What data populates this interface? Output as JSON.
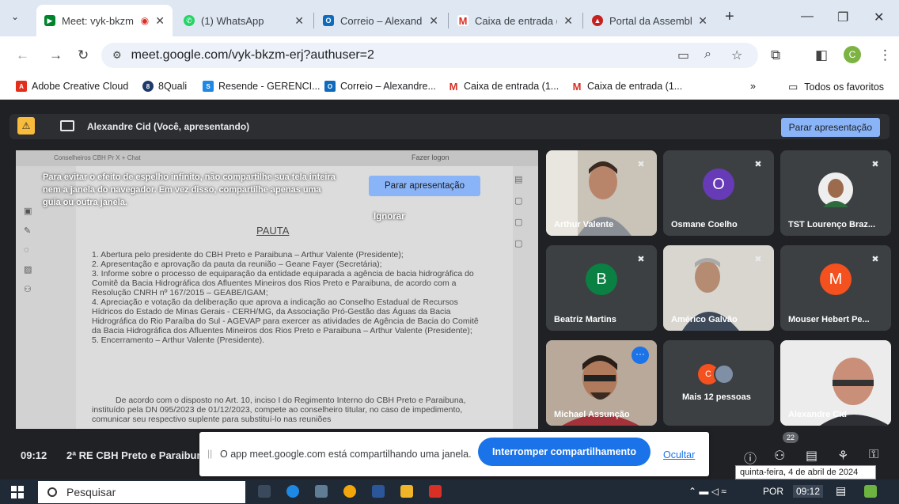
{
  "browser": {
    "tabs": [
      {
        "title": "Meet: vyk-bkzm",
        "active": true
      },
      {
        "title": "(1) WhatsApp",
        "active": false
      },
      {
        "title": "Correio – Alexandre",
        "active": false
      },
      {
        "title": "Caixa de entrada (",
        "active": false
      },
      {
        "title": "Portal da Assembl",
        "active": false
      }
    ],
    "new_tab": "+",
    "url": "meet.google.com/vyk-bkzm-erj?authuser=2",
    "profile_initial": "C",
    "bookmarks": [
      "Adobe Creative Cloud",
      "8Quali",
      "Resende - GERENCI...",
      "Correio – Alexandre...",
      "Caixa de entrada (1...",
      "Caixa de entrada (1..."
    ],
    "bookmarks_more": "»",
    "all_favorites": "Todos os favoritos"
  },
  "meet": {
    "presenter_text": "Alexandre Cid (Você, apresentando)",
    "stop_presenting": "Parar apresentação",
    "warning": "Para evitar o efeito de espelho infinito, não compartilhe sua tela inteira nem a janela do navegador. Em vez disso, compartilhe apenas uma guia ou outra janela.",
    "stop_presenting_2": "Parar apresentação",
    "ignore": "Ignorar",
    "shared_window": {
      "title_bits": "Conselheiros CBH Pr   X   + Chat",
      "login": "Fazer logon",
      "doc_title": "PAUTA",
      "items": [
        "1. Abertura pelo presidente do CBH Preto e Paraibuna – Arthur Valente (Presidente);",
        "2. Apresentação e aprovação da pauta da reunião – Geane Fayer (Secretária);",
        "3. Informe sobre o processo de equiparação da entidade equiparada a agência de bacia hidrográfica do Comitê da Bacia Hidrográfica dos Afluentes Mineiros dos Rios Preto e Paraibuna, de acordo com a Resolução CNRH nº 167/2015 – GEABE/IGAM;",
        "4. Apreciação e votação da deliberação que aprova a indicação ao Conselho Estadual de Recursos Hídricos do Estado de Minas Gerais - CERH/MG, da Associação Pró-Gestão das Águas da Bacia Hidrográfica do Rio Paraíba do Sul - AGEVAP para exercer as atividades de Agência de Bacia do Comitê da Bacia Hidrográfica dos Afluentes Mineiros dos Rios Preto e Paraibuna – Arthur Valente (Presidente);",
        "5. Encerramento – Arthur Valente (Presidente)."
      ],
      "paragraph": "De acordo com o disposto no Art. 10, inciso I do Regimento Interno do CBH Preto e Paraibuna, instituído pela DN 095/2023 de 01/12/2023, compete ao conselheiro titular, no caso de impedimento, comunicar seu respectivo suplente para substituí-lo nas reuniões"
    },
    "participants": [
      {
        "name": "Arthur Valente",
        "type": "photo"
      },
      {
        "name": "Osmane Coelho",
        "type": "avatar",
        "initial": "O",
        "color": "#673ab7"
      },
      {
        "name": "TST Lourenço Braz...",
        "type": "photo"
      },
      {
        "name": "Beatriz Martins",
        "type": "avatar",
        "initial": "B",
        "color": "#0b8043"
      },
      {
        "name": "Américo Galvão",
        "type": "photo"
      },
      {
        "name": "Mouser Hebert Pe...",
        "type": "avatar",
        "initial": "M",
        "color": "#f4511e"
      },
      {
        "name": "Michael Assunção",
        "type": "photo"
      },
      {
        "name": "Mais 12 pessoas",
        "type": "group",
        "initial": "C"
      },
      {
        "name": "Alexandre Cid",
        "type": "photo"
      }
    ],
    "time": "09:12",
    "meeting_name": "2ª RE CBH Preto e Paraibuna",
    "people_count": "22",
    "share_notice": "O app meet.google.com está compartilhando uma janela.",
    "stop_sharing": "Interromper compartilhamento",
    "hide": "Ocultar",
    "date_tooltip": "quinta-feira, 4 de abril de 2024"
  },
  "taskbar": {
    "search_placeholder": "Pesquisar",
    "lang": "POR",
    "clock": "09:12"
  }
}
